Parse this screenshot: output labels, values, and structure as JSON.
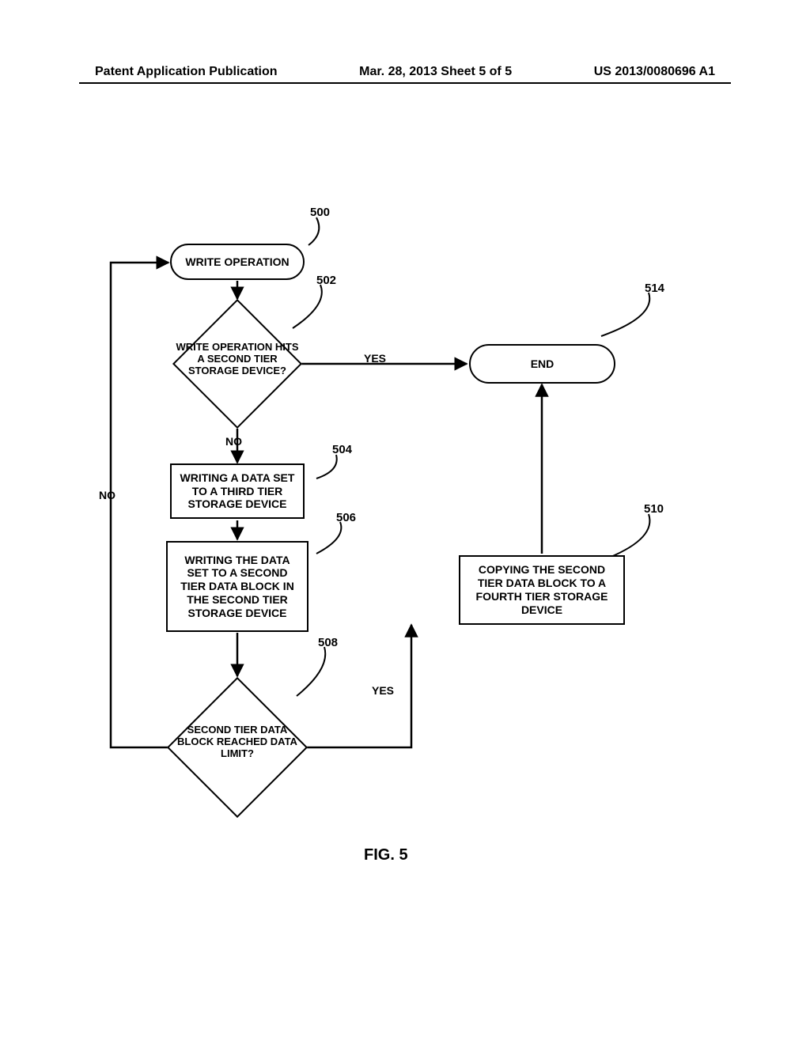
{
  "header": {
    "left": "Patent Application Publication",
    "mid": "Mar. 28, 2013  Sheet 5 of 5",
    "right": "US 2013/0080696 A1"
  },
  "nodes": {
    "n500": {
      "ref": "500",
      "text": "WRITE OPERATION"
    },
    "n502": {
      "ref": "502",
      "text": "WRITE OPERATION HITS A SECOND TIER STORAGE DEVICE?"
    },
    "n504": {
      "ref": "504",
      "text": "WRITING A DATA SET TO A THIRD TIER STORAGE DEVICE"
    },
    "n506": {
      "ref": "506",
      "text": "WRITING THE DATA SET TO A SECOND TIER DATA BLOCK IN THE SECOND TIER STORAGE DEVICE"
    },
    "n508": {
      "ref": "508",
      "text": "SECOND TIER DATA BLOCK REACHED DATA LIMIT?"
    },
    "n510": {
      "ref": "510",
      "text": "COPYING THE SECOND TIER DATA BLOCK TO A FOURTH TIER STORAGE DEVICE"
    },
    "n514": {
      "ref": "514",
      "text": "END"
    }
  },
  "edges": {
    "yes1": "YES",
    "no1": "NO",
    "yes2": "YES",
    "no2": "NO"
  },
  "figure_caption": "FIG. 5"
}
